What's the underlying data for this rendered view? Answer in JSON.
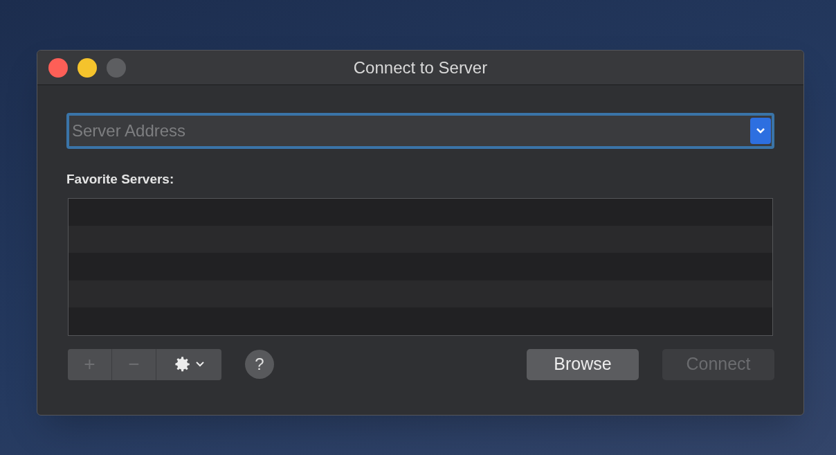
{
  "window": {
    "title": "Connect to Server",
    "controls": [
      {
        "kind": "close",
        "disabled": false
      },
      {
        "kind": "minimize",
        "disabled": false
      },
      {
        "kind": "zoom",
        "disabled": true
      }
    ]
  },
  "server_field": {
    "placeholder": "Server Address",
    "focused": true
  },
  "favorites": {
    "label": "Favorite Servers:"
  },
  "toolbar": {
    "add": {
      "label": "+",
      "disabled": true
    },
    "remove": {
      "label": "−",
      "disabled": true
    },
    "help": {
      "label": "?"
    }
  },
  "buttons": [
    {
      "label": "Browse",
      "disabled": false
    },
    {
      "label": "Connect",
      "disabled": true
    }
  ]
}
